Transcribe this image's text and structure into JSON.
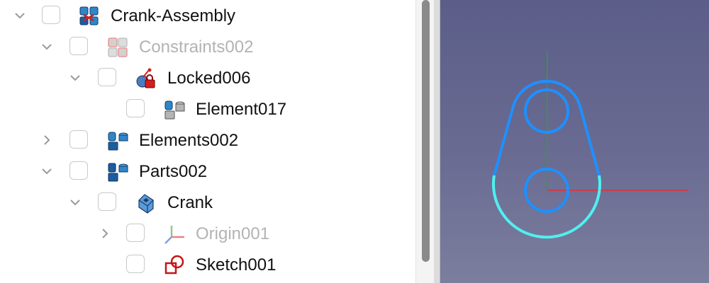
{
  "tree": {
    "items": [
      {
        "label": "Crank-Assembly",
        "icon": "assembly-icon",
        "expanded": true,
        "dimmed": false
      },
      {
        "label": "Constraints002",
        "icon": "constraints-group-icon",
        "expanded": true,
        "dimmed": true
      },
      {
        "label": "Locked006",
        "icon": "locked-constraint-icon",
        "expanded": true,
        "dimmed": false
      },
      {
        "label": "Element017",
        "icon": "element-icon",
        "expanded": null,
        "dimmed": false
      },
      {
        "label": "Elements002",
        "icon": "elements-group-icon",
        "expanded": false,
        "dimmed": false
      },
      {
        "label": "Parts002",
        "icon": "parts-group-icon",
        "expanded": true,
        "dimmed": false
      },
      {
        "label": "Crank",
        "icon": "part-icon",
        "expanded": true,
        "dimmed": false
      },
      {
        "label": "Origin001",
        "icon": "origin-icon",
        "expanded": false,
        "dimmed": true
      },
      {
        "label": "Sketch001",
        "icon": "sketch-icon",
        "expanded": null,
        "dimmed": false
      }
    ]
  },
  "viewport": {
    "background": "#62658e",
    "sketch_color": "#1e90ff",
    "highlight_color": "#4ff0f0",
    "x_axis_color": "#e0303a",
    "y_axis_color": "#2e9e3a"
  }
}
